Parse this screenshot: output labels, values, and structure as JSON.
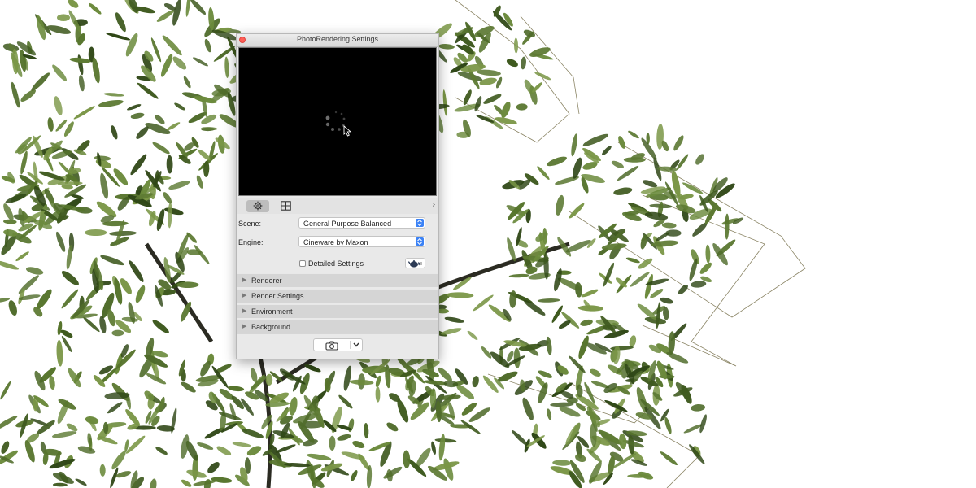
{
  "window": {
    "title": "PhotoRendering Settings"
  },
  "icons": {
    "close": "close-icon",
    "settings_tab": "gear-icon",
    "layout_tab": "grid-layout-icon",
    "expand": "chevron-right-icon",
    "spinner": "loading-spinner-icon",
    "material_preview": "teapot-icon",
    "render": "camera-icon",
    "render_menu": "chevron-down-icon",
    "collapsed": "triangle-right-icon"
  },
  "scene": {
    "label": "Scene:",
    "value": "General Purpose Balanced"
  },
  "engine": {
    "label": "Engine:",
    "value": "Cineware by Maxon"
  },
  "detailed_settings": {
    "label": "Detailed Settings",
    "checked": false
  },
  "sections": [
    {
      "label": "Renderer",
      "expanded": false
    },
    {
      "label": "Render Settings",
      "expanded": false
    },
    {
      "label": "Environment",
      "expanded": false
    },
    {
      "label": "Background",
      "expanded": false
    }
  ],
  "colors": {
    "accent": "#3b82f6",
    "close": "#ff5f57",
    "foliage": "#4f6b2a",
    "preview_bg": "#000000"
  }
}
